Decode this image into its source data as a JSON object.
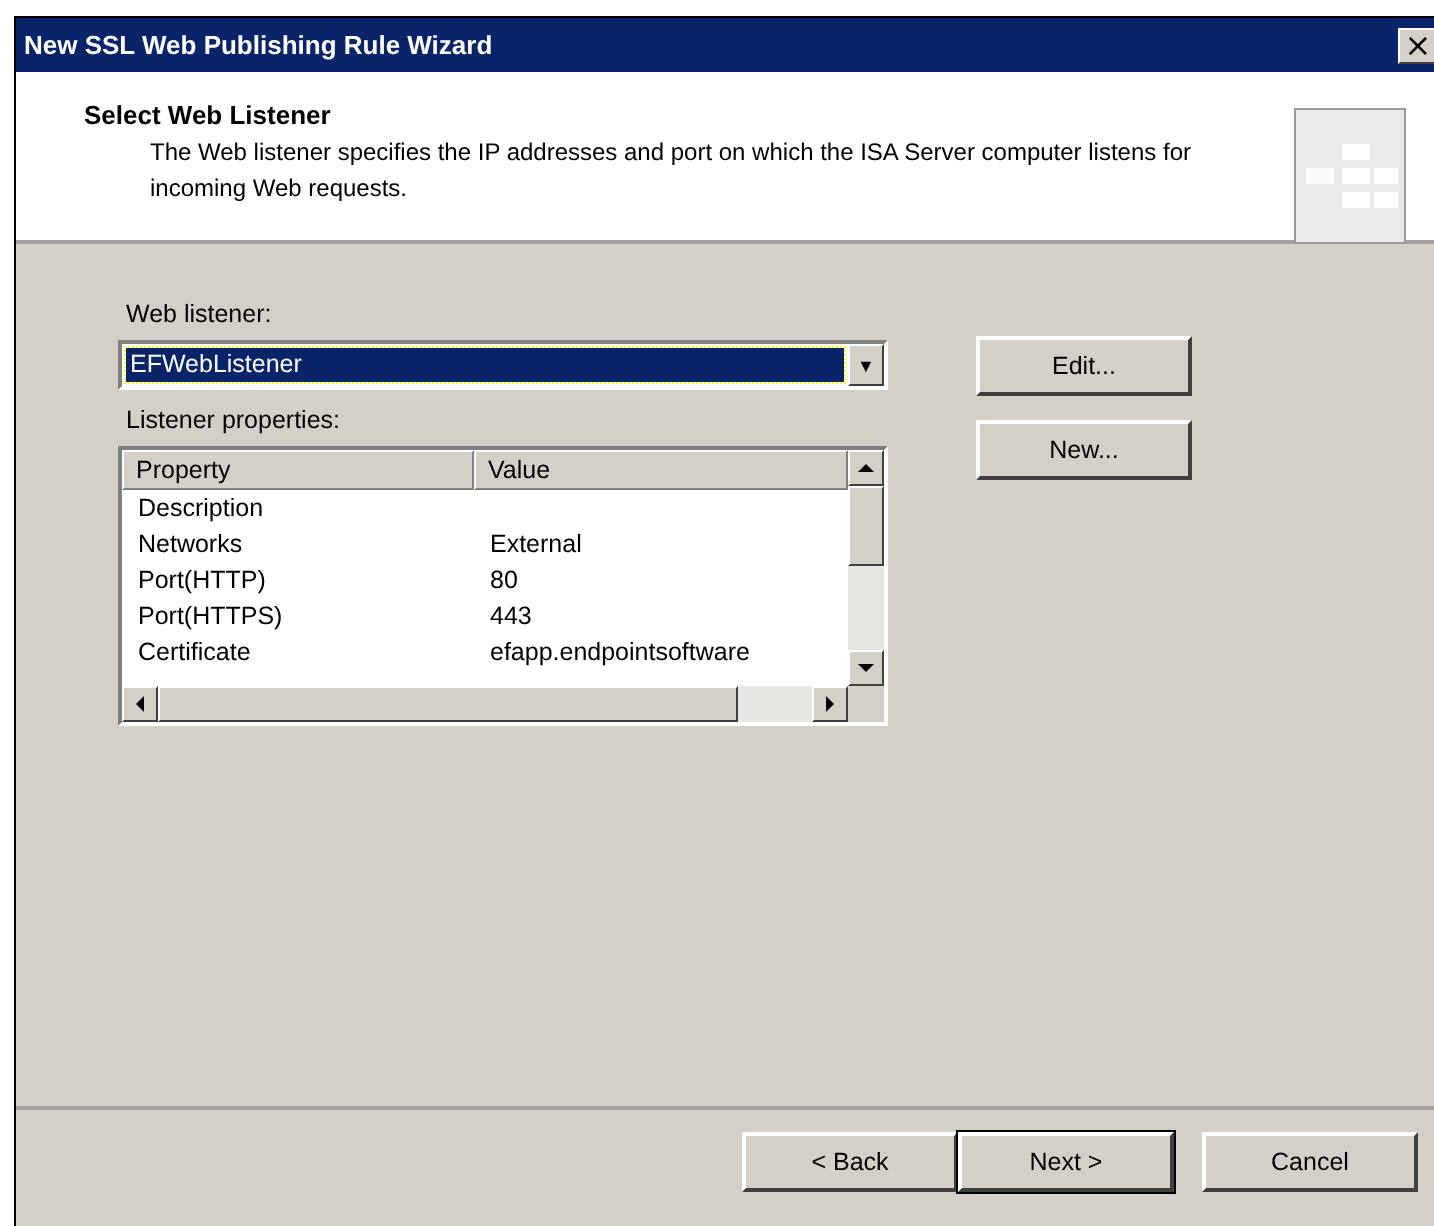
{
  "window": {
    "title": "New SSL Web Publishing Rule Wizard",
    "close": "×"
  },
  "header": {
    "title": "Select Web Listener",
    "description": "The Web listener specifies the IP addresses and port on which the ISA Server computer listens for incoming Web requests."
  },
  "listener": {
    "label": "Web listener:",
    "value": "EFWebListener",
    "arrow": "▼"
  },
  "properties": {
    "label": "Listener properties:",
    "columns": [
      "Property",
      "Value"
    ],
    "rows": [
      [
        "Description",
        ""
      ],
      [
        "Networks",
        "External"
      ],
      [
        "Port(HTTP)",
        "80"
      ],
      [
        "Port(HTTPS)",
        "443"
      ],
      [
        "Certificate",
        "efapp.endpointsoftware"
      ]
    ]
  },
  "side_buttons": [
    "Edit...",
    "New..."
  ],
  "footer_buttons": [
    {
      "label": "< Back",
      "default": false
    },
    {
      "label": "Next >",
      "default": true
    },
    {
      "label": "Cancel",
      "default": false
    }
  ]
}
